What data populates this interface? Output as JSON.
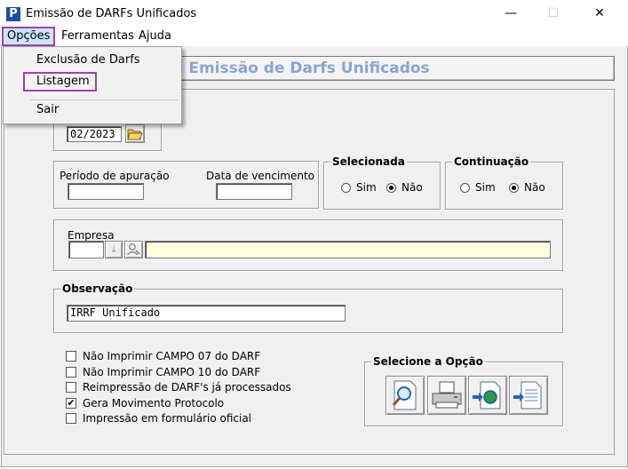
{
  "window": {
    "title": "Emissão de DARFs Unificados",
    "app_icon_letter": "P",
    "minimize": "—",
    "maximize": "☐",
    "close": "✕"
  },
  "menubar": {
    "items": [
      {
        "label": "Opções",
        "active": true
      },
      {
        "label": "Ferramentas"
      },
      {
        "label": "Ajuda"
      }
    ]
  },
  "dropdown": {
    "items": [
      {
        "label": "Exclusão de Darfs"
      },
      {
        "label": "Listagem",
        "highlighted": true
      },
      {
        "label": "Sair"
      }
    ]
  },
  "banner": {
    "title": "Emissão de Darfs Unificados"
  },
  "competencia": {
    "value": "02/2023"
  },
  "periodo": {
    "label": "Período de apuração",
    "value": ""
  },
  "vencimento": {
    "label": "Data de vencimento",
    "value": ""
  },
  "selecionada": {
    "title": "Selecionada",
    "sim": "Sim",
    "nao": "Não",
    "selected": "Não"
  },
  "continuacao": {
    "title": "Continuação",
    "sim": "Sim",
    "nao": "Não",
    "selected": "Não"
  },
  "empresa": {
    "label": "Empresa",
    "code": "",
    "name": ""
  },
  "observacao": {
    "title": "Observação",
    "value": "IRRF Unificado"
  },
  "checkboxes": [
    {
      "label": "Não Imprimir CAMPO 07 do DARF",
      "checked": false
    },
    {
      "label": "Não Imprimir CAMPO 10 do DARF",
      "checked": false
    },
    {
      "label": "Reimpressão de DARF's já processados",
      "checked": false
    },
    {
      "label": "Gera Movimento Protocolo",
      "checked": true
    },
    {
      "label": "Impressão em formulário oficial",
      "checked": false
    }
  ],
  "opcao": {
    "title": "Selecione a Opção"
  },
  "icons": {
    "folder": "folder-open-icon",
    "preview": "magnifier-page-icon",
    "printer": "printer-icon",
    "export": "export-page-icon",
    "document": "document-icon"
  },
  "colors": {
    "banner_text": "#8aa5cf",
    "highlight": "#a040a8",
    "field_yellow": "#ffffe1"
  },
  "check_mark": "✔"
}
